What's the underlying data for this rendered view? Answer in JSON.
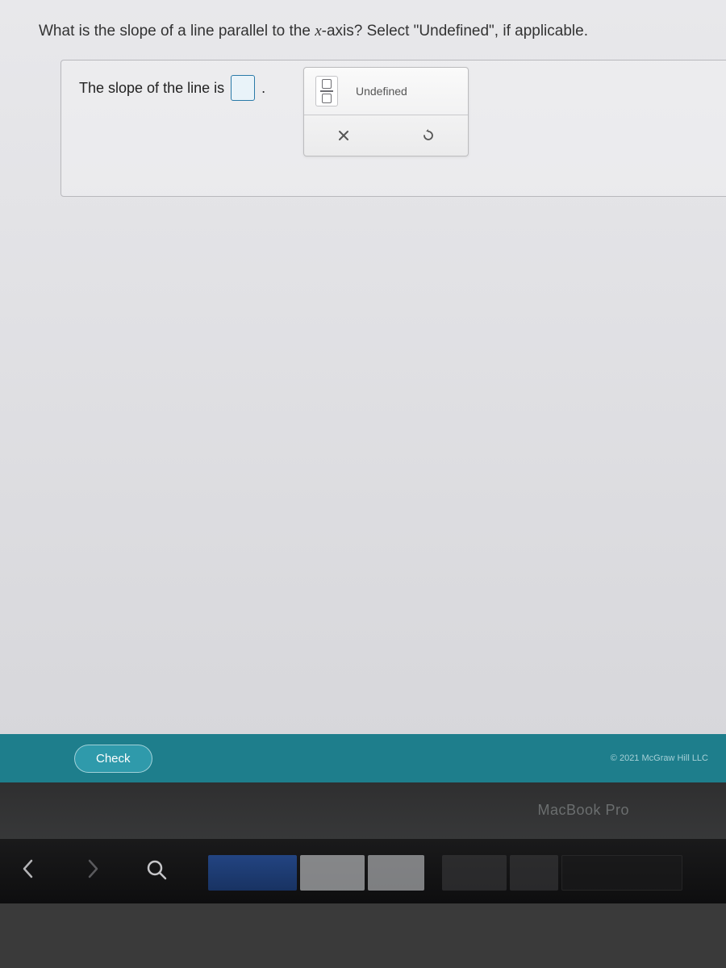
{
  "question": {
    "prompt_pre": "What is the slope of a line parallel to the ",
    "prompt_var": "x",
    "prompt_post": "-axis? Select \"Undefined\", if applicable."
  },
  "answer": {
    "sentence": "The slope of the line is",
    "value": "",
    "period": "."
  },
  "toolbox": {
    "undefined_label": "Undefined"
  },
  "footer": {
    "check_label": "Check",
    "copyright": "© 2021 McGraw Hill LLC"
  },
  "device": {
    "label": "MacBook Pro"
  }
}
